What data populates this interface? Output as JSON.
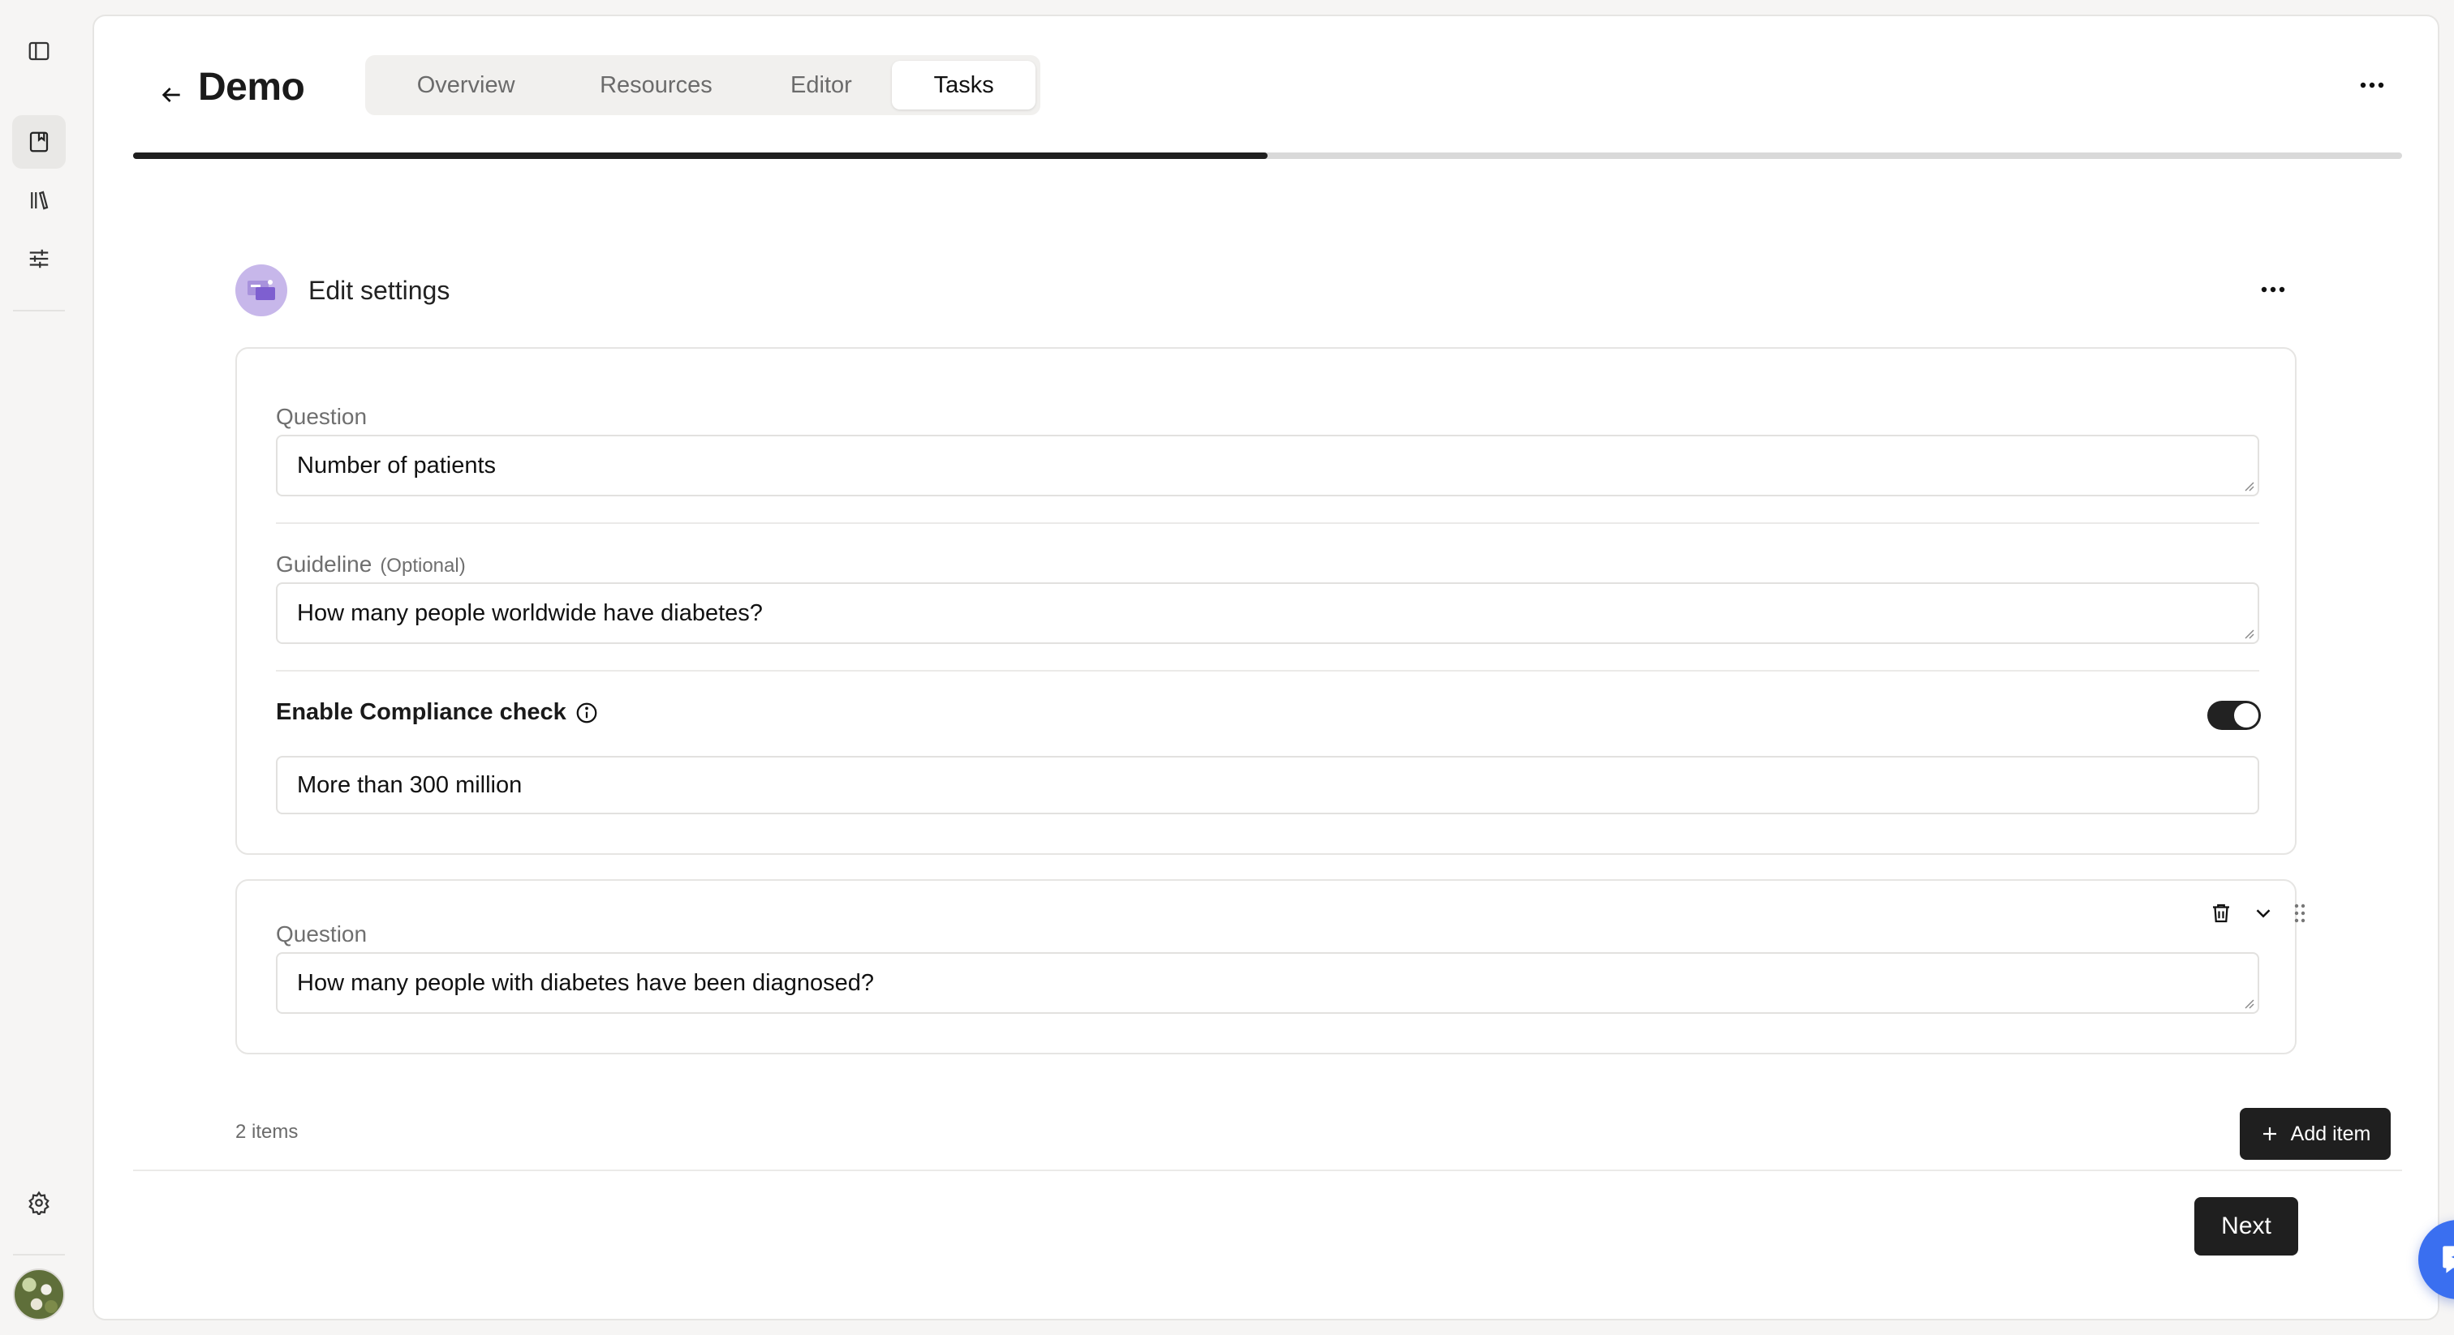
{
  "header": {
    "title": "Demo",
    "tabs": [
      {
        "label": "Overview",
        "active": false
      },
      {
        "label": "Resources",
        "active": false
      },
      {
        "label": "Editor",
        "active": false
      },
      {
        "label": "Tasks",
        "active": true
      }
    ],
    "progress_fraction": 0.5
  },
  "section": {
    "title": "Edit settings"
  },
  "items": [
    {
      "question_label": "Question",
      "question_value": "Number of patients",
      "guideline_label": "Guideline",
      "guideline_optional": "(Optional)",
      "guideline_value": "How many people worldwide have diabetes?",
      "compliance_label": "Enable Compliance check",
      "compliance_enabled": true,
      "compliance_value": "More than 300 million"
    },
    {
      "question_label": "Question",
      "question_value": "How many people with diabetes have been diagnosed?"
    }
  ],
  "footer": {
    "count": "2 items",
    "add_label": "Add item",
    "next_label": "Next"
  },
  "icons": {
    "sidebar_toggle": "sidebar-toggle-icon",
    "bookmark": "bookmark-icon",
    "library": "library-icon",
    "sliders": "sliders-icon",
    "settings": "gear-icon",
    "back": "arrow-left-icon",
    "more": "more-horizontal-icon",
    "info": "info-icon",
    "trash": "trash-icon",
    "chevron": "chevron-down-icon",
    "drag": "drag-handle-icon",
    "plus": "plus-icon",
    "assistant": "sparkle-chat-icon"
  },
  "colors": {
    "accent": "#3a6ff0",
    "primary_button": "#1f1f1f",
    "section_icon_bg": "#c7b7ea"
  }
}
